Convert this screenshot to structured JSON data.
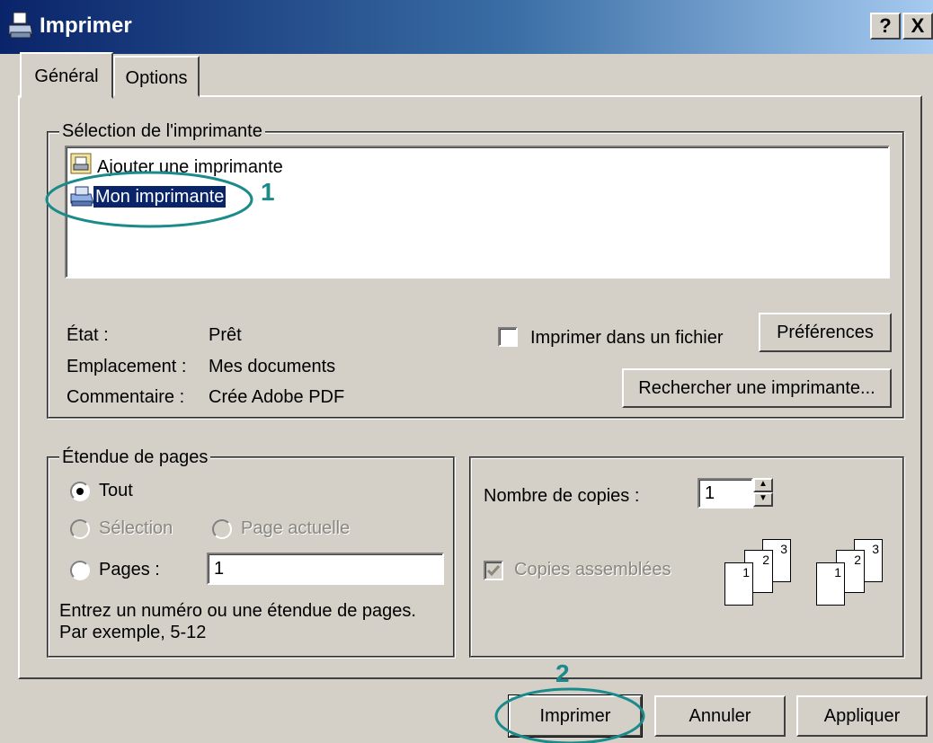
{
  "window": {
    "title": "Imprimer",
    "help_btn": "?",
    "close_btn": "X"
  },
  "tabs": [
    {
      "label": "Général",
      "active": true
    },
    {
      "label": "Options",
      "active": false
    }
  ],
  "printer_selection": {
    "title": "Sélection de l'imprimante",
    "printers": [
      {
        "name": "Ajouter une imprimante",
        "icon": "add-printer-icon"
      },
      {
        "name": "Mon imprimante",
        "icon": "printer-icon",
        "selected": true
      }
    ],
    "status_label": "État :",
    "status_value": "Prêt",
    "location_label": "Emplacement :",
    "location_value": "Mes documents",
    "comment_label": "Commentaire :",
    "comment_value": "Crée Adobe PDF",
    "print_to_file_label": "Imprimer dans un fichier",
    "preferences_button": "Préférences",
    "find_printer_button": "Rechercher une imprimante..."
  },
  "page_range": {
    "title": "Étendue de pages",
    "all_label": "Tout",
    "selection_label": "Sélection",
    "current_page_label": "Page actuelle",
    "pages_label": "Pages :",
    "pages_value": "1",
    "hint_line1": "Entrez un numéro ou une étendue de pages.",
    "hint_line2": "Par exemple, 5-12"
  },
  "copies": {
    "count_label": "Nombre de copies :",
    "count_value": "1",
    "collate_label": "Copies assemblées",
    "collate_pages": [
      "1",
      "2",
      "3"
    ]
  },
  "buttons": {
    "print": "Imprimer",
    "cancel": "Annuler",
    "apply": "Appliquer"
  },
  "annotations": {
    "step1": "1",
    "step2": "2"
  },
  "colors": {
    "annotation": "#1a8a8a",
    "selection": "#0a246a",
    "dialog": "#d4d0c8"
  }
}
